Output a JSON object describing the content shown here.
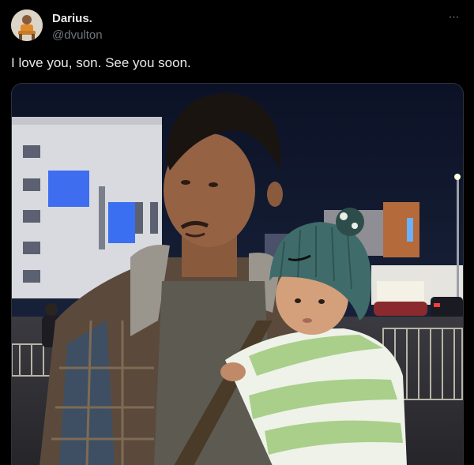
{
  "author": {
    "display_name": "Darius.",
    "handle": "@dvulton",
    "avatar_icon": "user-avatar"
  },
  "more_menu": {
    "icon": "more-horizontal-icon",
    "label": "···"
  },
  "tweet": {
    "text": "I love you, son. See you soon."
  },
  "media": {
    "kind": "photo",
    "alt": ""
  },
  "colors": {
    "background": "#000000",
    "primary_text": "#e7e9ea",
    "secondary_text": "#71767b",
    "border": "#2f3336"
  }
}
